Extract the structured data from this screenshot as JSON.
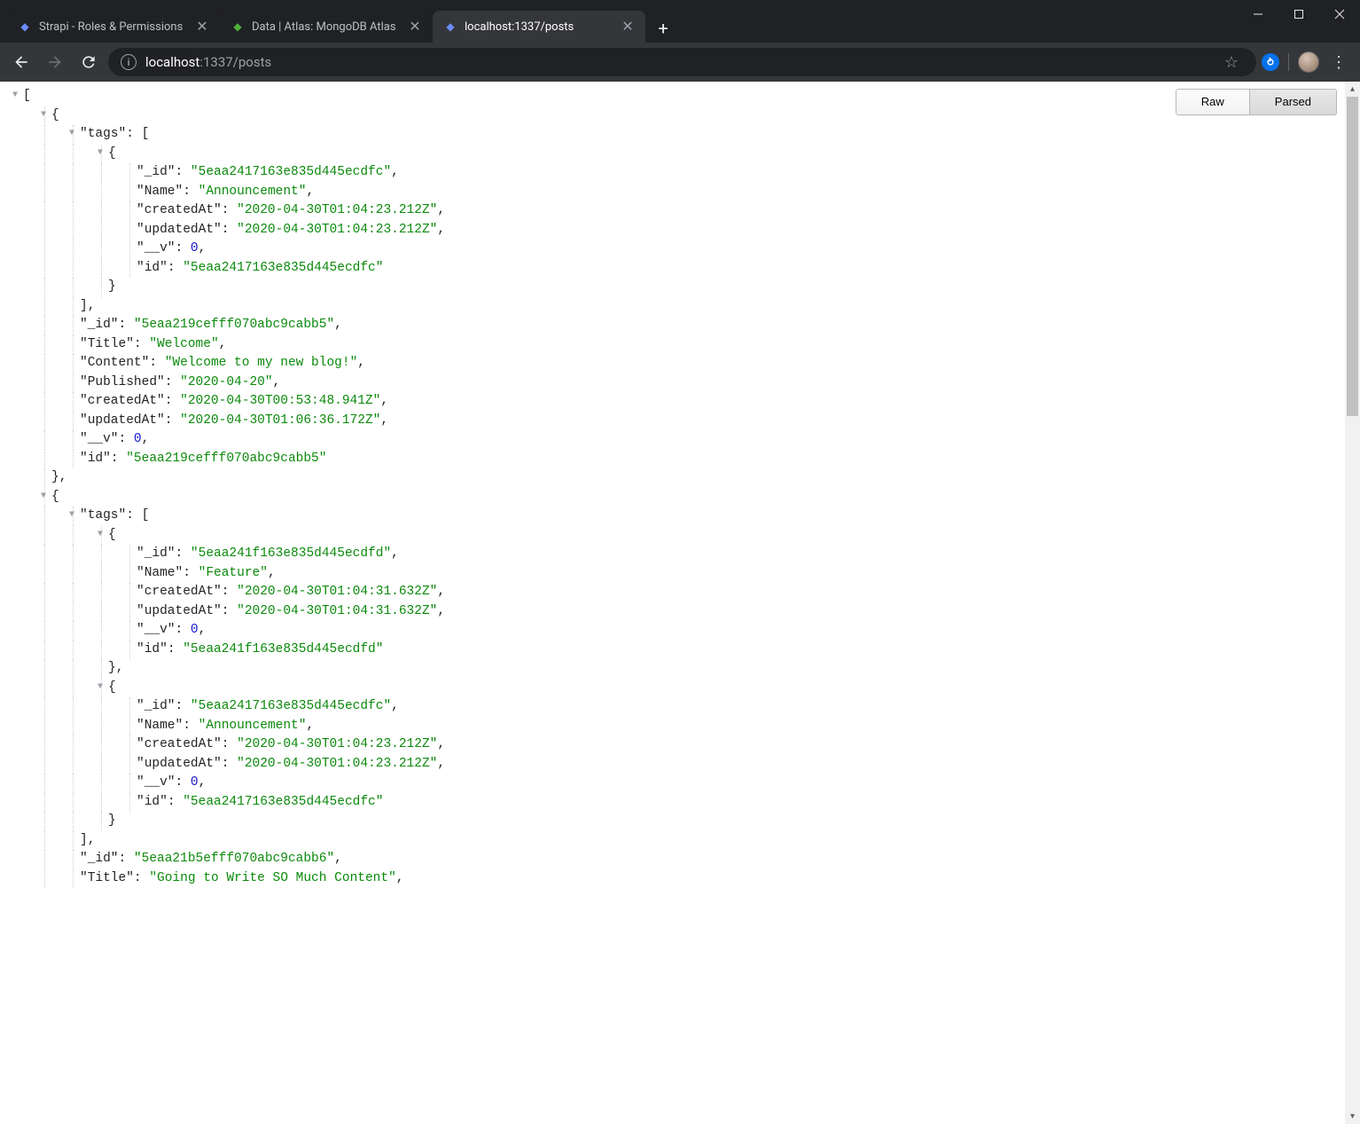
{
  "window": {
    "title": "localhost:1337/posts",
    "tabs": [
      {
        "title": "Strapi - Roles & Permissions",
        "favicon": "strapi",
        "active": false
      },
      {
        "title": "Data | Atlas: MongoDB Atlas",
        "favicon": "mongo",
        "active": false
      },
      {
        "title": "localhost:1337/posts",
        "favicon": "local",
        "active": true
      }
    ]
  },
  "address_bar": {
    "host": "localhost",
    "path": ":1337/posts"
  },
  "view_toggle": {
    "raw": "Raw",
    "parsed": "Parsed",
    "active": "parsed"
  },
  "json_response": [
    {
      "tags": [
        {
          "_id": "5eaa2417163e835d445ecdfc",
          "Name": "Announcement",
          "createdAt": "2020-04-30T01:04:23.212Z",
          "updatedAt": "2020-04-30T01:04:23.212Z",
          "__v": 0,
          "id": "5eaa2417163e835d445ecdfc"
        }
      ],
      "_id": "5eaa219cefff070abc9cabb5",
      "Title": "Welcome",
      "Content": "Welcome to my new blog!",
      "Published": "2020-04-20",
      "createdAt": "2020-04-30T00:53:48.941Z",
      "updatedAt": "2020-04-30T01:06:36.172Z",
      "__v": 0,
      "id": "5eaa219cefff070abc9cabb5"
    },
    {
      "tags": [
        {
          "_id": "5eaa241f163e835d445ecdfd",
          "Name": "Feature",
          "createdAt": "2020-04-30T01:04:31.632Z",
          "updatedAt": "2020-04-30T01:04:31.632Z",
          "__v": 0,
          "id": "5eaa241f163e835d445ecdfd"
        },
        {
          "_id": "5eaa2417163e835d445ecdfc",
          "Name": "Announcement",
          "createdAt": "2020-04-30T01:04:23.212Z",
          "updatedAt": "2020-04-30T01:04:23.212Z",
          "__v": 0,
          "id": "5eaa2417163e835d445ecdfc"
        }
      ],
      "_id": "5eaa21b5efff070abc9cabb6",
      "Title": "Going to Write SO Much Content"
    }
  ]
}
